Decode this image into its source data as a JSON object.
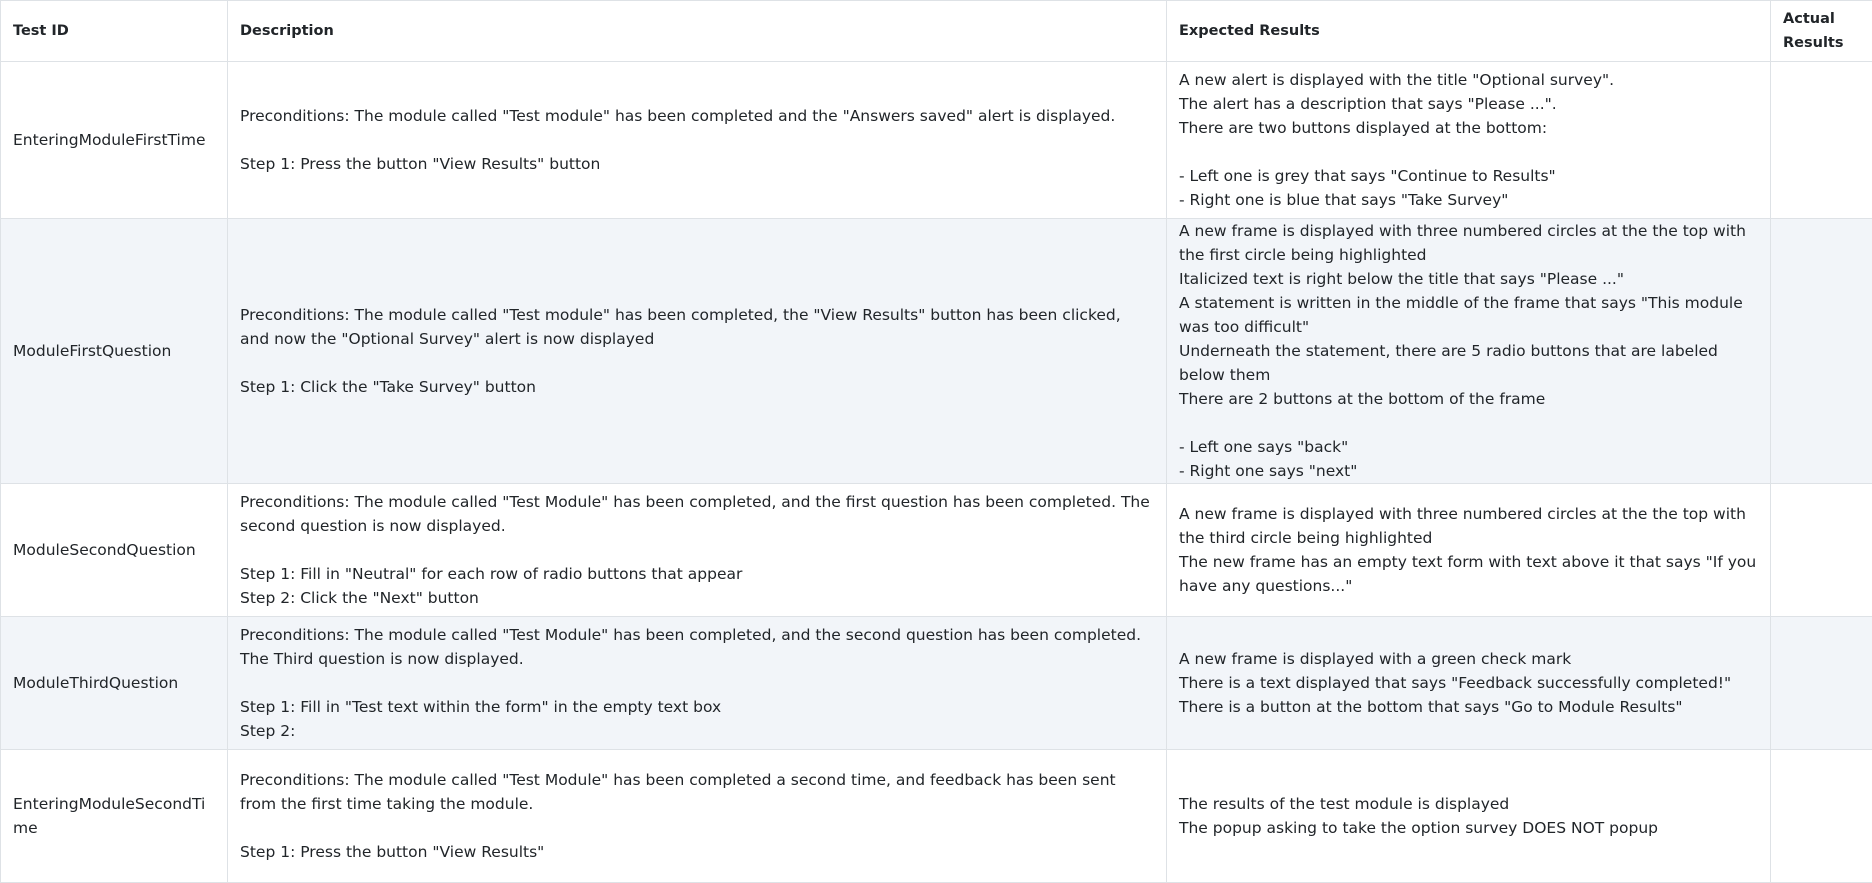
{
  "table": {
    "headers": {
      "test_id": "Test ID",
      "description": "Description",
      "expected_results": "Expected Results",
      "actual_results": "Actual Results"
    },
    "rows": [
      {
        "test_id": "EnteringModuleFirstTime",
        "description": "Preconditions: The module called \"Test module\" has been completed and the \"Answers saved\" alert is displayed.\n\nStep 1: Press the button \"View Results\" button",
        "expected_results": "A new alert is displayed with the title \"Optional survey\".\nThe alert has a description that says \"Please ...\".\nThere are two buttons displayed at the bottom:\n\n- Left one is grey that says \"Continue to Results\"\n- Right one is blue that says \"Take Survey\"",
        "actual_results": ""
      },
      {
        "test_id": "ModuleFirstQuestion",
        "description": "Preconditions: The module called \"Test module\" has been completed, the \"View Results\" button has been clicked, and now the \"Optional Survey\" alert is now displayed\n\nStep 1: Click the \"Take Survey\" button",
        "expected_results": "A new frame is displayed with three numbered circles at the the top with the first circle being highlighted\nItalicized text is right below the title that says \"Please ...\"\nA statement is written in the middle of the frame that says \"This module was too difficult\"\nUnderneath the statement, there are 5 radio buttons that are labeled below them\nThere are 2 buttons at the bottom of the frame\n\n- Left one says \"back\"\n- Right one says \"next\"",
        "actual_results": ""
      },
      {
        "test_id": "ModuleSecondQuestion",
        "description": "Preconditions: The module called \"Test Module\" has been completed, and the first question has been completed. The second question is now displayed.\n\nStep 1: Fill in \"Neutral\" for each row of radio buttons that appear\nStep 2: Click the \"Next\" button",
        "expected_results": "A new frame is displayed with three numbered circles at the the top with the third circle being highlighted\nThe new frame has an empty text form with text above it that says \"If you have any questions...\"",
        "actual_results": ""
      },
      {
        "test_id": "ModuleThirdQuestion",
        "description": "Preconditions: The module called \"Test Module\" has been completed, and the second question has been completed. The Third question is now displayed.\n\nStep 1: Fill in \"Test text within the form\" in the empty text box\nStep 2:",
        "expected_results": "A new frame is displayed with a green check mark\nThere is a text displayed that says \"Feedback successfully completed!\"\nThere is a button at the bottom that says \"Go to Module Results\"",
        "actual_results": ""
      },
      {
        "test_id": "EnteringModuleSecondTime",
        "description": "Preconditions: The module called \"Test Module\" has been completed a second time, and feedback has been sent from the first time taking the module.\n\nStep 1: Press the button \"View Results\"",
        "expected_results": "The results of the test module is displayed\nThe popup asking to take the option survey DOES NOT popup",
        "actual_results": ""
      }
    ]
  }
}
